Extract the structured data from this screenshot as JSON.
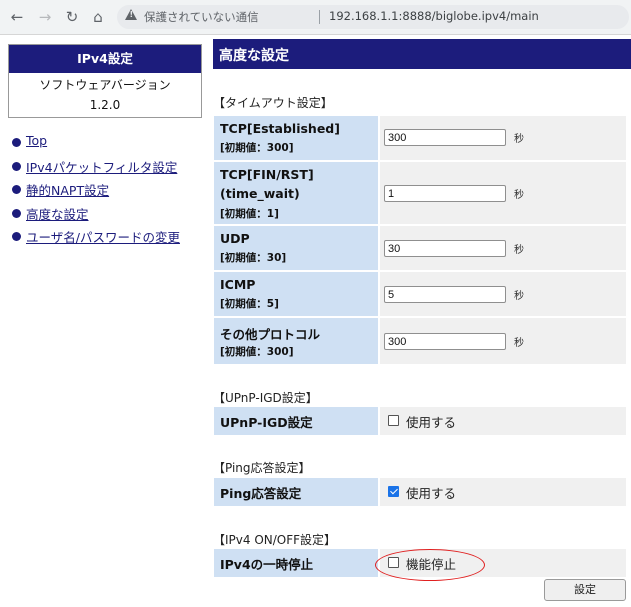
{
  "browser": {
    "back_icon": "arrow-left-icon",
    "forward_icon": "arrow-right-icon",
    "reload_icon": "reload-icon",
    "home_icon": "home-icon",
    "insecure_label": "保護されていない通信",
    "url": "192.168.1.1:8888/biglobe.ipv4/main"
  },
  "sidebar": {
    "title": "IPv4設定",
    "version_label": "ソフトウェアバージョン",
    "version": "1.2.0",
    "links": [
      "Top",
      "IPv4パケットフィルタ設定",
      "静的NAPT設定",
      "高度な設定",
      "ユーザ名/パスワードの変更"
    ]
  },
  "main": {
    "title": "高度な設定",
    "timeout": {
      "heading": "【タイムアウト設定】",
      "unit": "秒",
      "rows": [
        {
          "label": "TCP[Established]",
          "default": "[初期値：300]",
          "value": "300"
        },
        {
          "label": "TCP[FIN/RST]",
          "label2": "(time_wait)",
          "default": "[初期値：1]",
          "value": "1"
        },
        {
          "label": "UDP",
          "default": "[初期値：30]",
          "value": "30"
        },
        {
          "label": "ICMP",
          "default": "[初期値：5]",
          "value": "5"
        },
        {
          "label": "その他プロトコル",
          "default": "[初期値：300]",
          "value": "300"
        }
      ]
    },
    "upnp": {
      "heading": "【UPnP-IGD設定】",
      "label": "UPnP-IGD設定",
      "option": "使用する",
      "checked": false
    },
    "ping": {
      "heading": "【Ping応答設定】",
      "label": "Ping応答設定",
      "option": "使用する",
      "checked": true
    },
    "ipv4": {
      "heading": "【IPv4 ON/OFF設定】",
      "label": "IPv4の一時停止",
      "option": "機能停止",
      "checked": false
    },
    "submit_label": "設定"
  },
  "colors": {
    "navy": "#1c1c7c",
    "label_bg": "#cfe0f3",
    "value_bg": "#f0f0f0",
    "annotation": "#e02020",
    "checkbox_on": "#1a73e8"
  }
}
